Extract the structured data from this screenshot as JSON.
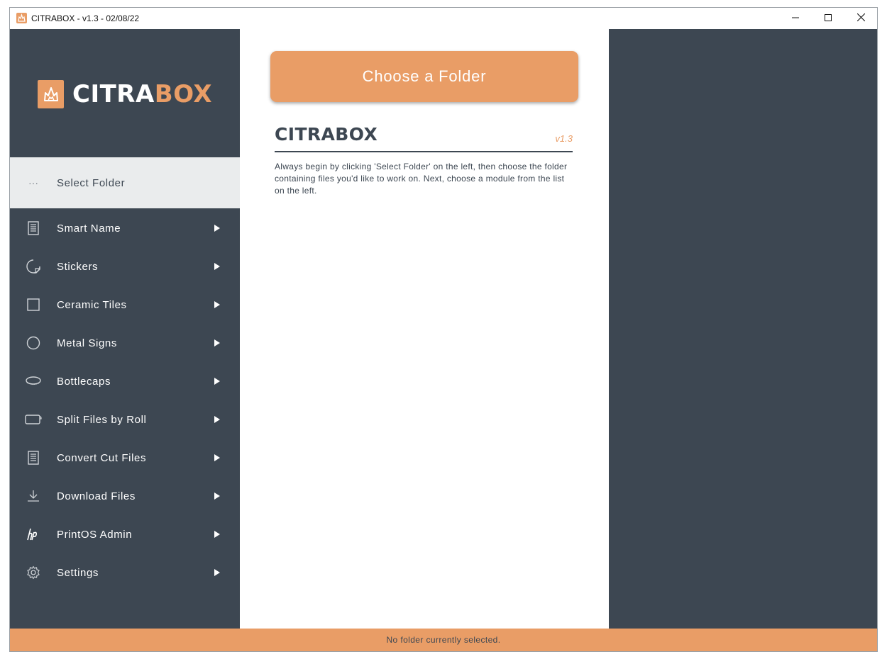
{
  "window": {
    "title": "CITRABOX - v1.3 - 02/08/22",
    "controls": {
      "minimize_icon": "minimize-icon",
      "maximize_icon": "maximize-icon",
      "close_icon": "close-icon"
    }
  },
  "brand": {
    "logo_white": "CITRA",
    "logo_orange": "BOX",
    "accent_color": "#e99d66",
    "dark_color": "#3d4752"
  },
  "sidebar": {
    "select_folder": {
      "icon": "ellipsis-icon",
      "dots": "···",
      "label": "Select Folder"
    },
    "items": [
      {
        "label": "Smart Name",
        "icon": "document-icon"
      },
      {
        "label": "Stickers",
        "icon": "sticker-icon"
      },
      {
        "label": "Ceramic Tiles",
        "icon": "tile-square-icon"
      },
      {
        "label": "Metal Signs",
        "icon": "circle-icon"
      },
      {
        "label": "Bottlecaps",
        "icon": "bottlecap-icon"
      },
      {
        "label": "Split Files by Roll",
        "icon": "roll-icon"
      },
      {
        "label": "Convert Cut Files",
        "icon": "document-icon"
      },
      {
        "label": "Download Files",
        "icon": "download-icon"
      },
      {
        "label": "PrintOS Admin",
        "icon": "hp-logo-icon"
      },
      {
        "label": "Settings",
        "icon": "gear-icon"
      }
    ]
  },
  "main": {
    "choose_button": "Choose a Folder",
    "heading": "CITRABOX",
    "version": "v1.3",
    "description": "Always begin by clicking 'Select Folder' on the left, then choose the folder containing files you'd like to work on. Next, choose a module from the list on the left."
  },
  "status": {
    "text": "No folder currently selected."
  }
}
